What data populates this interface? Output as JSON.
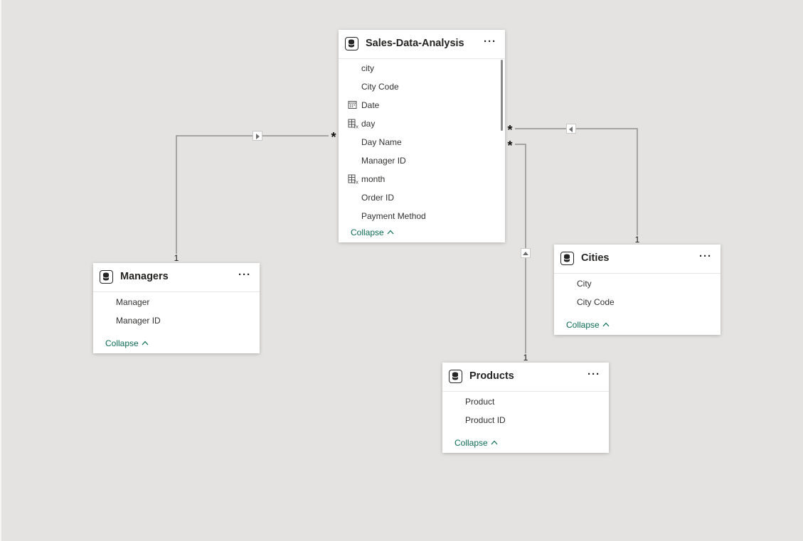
{
  "tables": [
    {
      "id": "sales",
      "title": "Sales-Data-Analysis",
      "fields": [
        {
          "label": "city",
          "icon": "none"
        },
        {
          "label": "City Code",
          "icon": "none"
        },
        {
          "label": "Date",
          "icon": "calendar-icon"
        },
        {
          "label": "day",
          "icon": "calculated-column-icon"
        },
        {
          "label": "Day Name",
          "icon": "none"
        },
        {
          "label": "Manager ID",
          "icon": "none"
        },
        {
          "label": "month",
          "icon": "calculated-column-icon"
        },
        {
          "label": "Order ID",
          "icon": "none"
        },
        {
          "label": "Payment Method",
          "icon": "none"
        }
      ],
      "collapse_label": "Collapse",
      "more_label": "···"
    },
    {
      "id": "managers",
      "title": "Managers",
      "fields": [
        {
          "label": "Manager",
          "icon": "none"
        },
        {
          "label": "Manager ID",
          "icon": "none"
        }
      ],
      "collapse_label": "Collapse",
      "more_label": "···"
    },
    {
      "id": "cities",
      "title": "Cities",
      "fields": [
        {
          "label": "City",
          "icon": "none"
        },
        {
          "label": "City Code",
          "icon": "none"
        }
      ],
      "collapse_label": "Collapse",
      "more_label": "···"
    },
    {
      "id": "products",
      "title": "Products",
      "fields": [
        {
          "label": "Product",
          "icon": "none"
        },
        {
          "label": "Product ID",
          "icon": "none"
        }
      ],
      "collapse_label": "Collapse",
      "more_label": "···"
    }
  ],
  "relationships": [
    {
      "from": "Managers",
      "to": "Sales-Data-Analysis",
      "from_cardinality": "1",
      "to_cardinality": "*",
      "filter_direction": "right"
    },
    {
      "from": "Cities",
      "to": "Sales-Data-Analysis",
      "from_cardinality": "1",
      "to_cardinality": "*",
      "filter_direction": "left"
    },
    {
      "from": "Products",
      "to": "Sales-Data-Analysis",
      "from_cardinality": "1",
      "to_cardinality": "*",
      "filter_direction": "up"
    }
  ],
  "colors": {
    "canvas": "#e4e3e1",
    "card": "#ffffff",
    "link": "#0b6a53",
    "relationship_line": "#8f8f8f"
  }
}
